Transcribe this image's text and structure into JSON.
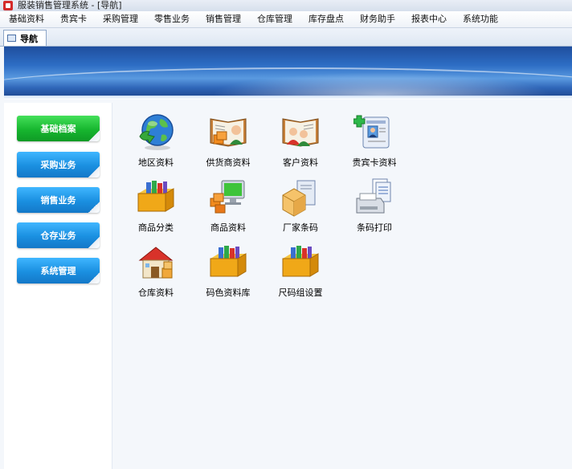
{
  "window": {
    "title": "服装销售管理系统 - [导航]"
  },
  "menu": [
    "基础资料",
    "贵宾卡",
    "采购管理",
    "零售业务",
    "销售管理",
    "仓库管理",
    "库存盘点",
    "财务助手",
    "报表中心",
    "系统功能"
  ],
  "tabs": [
    {
      "label": "导航",
      "active": true
    }
  ],
  "sidebar": {
    "items": [
      {
        "label": "基础档案",
        "active": true
      },
      {
        "label": "采购业务",
        "active": false
      },
      {
        "label": "销售业务",
        "active": false
      },
      {
        "label": "仓存业务",
        "active": false
      },
      {
        "label": "系统管理",
        "active": false
      }
    ]
  },
  "grid": {
    "items": [
      {
        "label": "地区资料",
        "icon": "globe-icon"
      },
      {
        "label": "供货商资料",
        "icon": "supplier-book-icon"
      },
      {
        "label": "客户资料",
        "icon": "customer-book-icon"
      },
      {
        "label": "贵宾卡资料",
        "icon": "vip-card-icon"
      },
      {
        "label": "商品分类",
        "icon": "book-shelf-icon"
      },
      {
        "label": "商品资料",
        "icon": "product-computer-icon"
      },
      {
        "label": "厂家条码",
        "icon": "barcode-box-icon"
      },
      {
        "label": "条码打印",
        "icon": "printer-icon"
      },
      {
        "label": "仓库资料",
        "icon": "warehouse-house-icon"
      },
      {
        "label": "码色资料库",
        "icon": "book-shelf-icon"
      },
      {
        "label": "尺码组设置",
        "icon": "book-shelf-icon"
      }
    ]
  },
  "colors": {
    "sidebar_active": "#17b62f",
    "sidebar_button": "#1a8fe0",
    "banner": "#2d6dc4"
  }
}
